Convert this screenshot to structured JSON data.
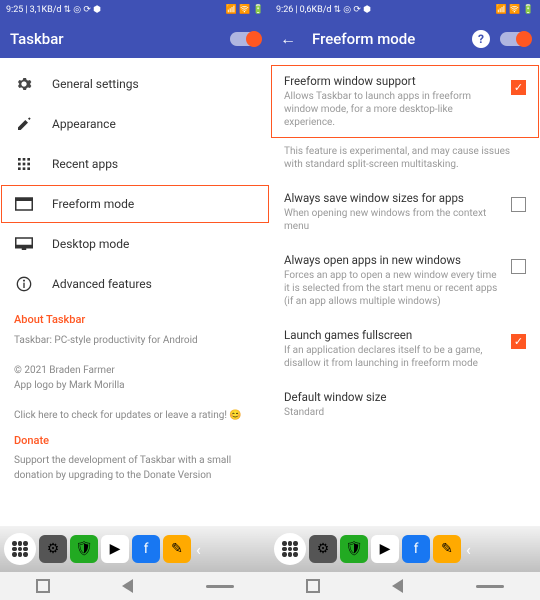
{
  "left": {
    "status": {
      "time": "9:25",
      "net": "3,1KB/d",
      "icons": "⇅ ◎ ⟳ ⬢"
    },
    "appTitle": "Taskbar",
    "menu": [
      {
        "label": "General settings",
        "icon": "gear"
      },
      {
        "label": "Appearance",
        "icon": "pencil"
      },
      {
        "label": "Recent apps",
        "icon": "grid"
      },
      {
        "label": "Freeform mode",
        "icon": "window"
      },
      {
        "label": "Desktop mode",
        "icon": "desktop"
      },
      {
        "label": "Advanced features",
        "icon": "info"
      }
    ],
    "about": {
      "heading": "About Taskbar",
      "tagline": "Taskbar: PC-style productivity for Android",
      "copyright": "© 2021 Braden Farmer",
      "logo": "App logo by Mark Morilla",
      "update": "Click here to check for updates or leave a rating! 😊",
      "donateHeading": "Donate",
      "donateText": "Support the development of Taskbar with a small donation by upgrading to the Donate Version"
    }
  },
  "right": {
    "status": {
      "time": "9:26",
      "net": "0,6KB/d",
      "icons": "⇅ ◎ ⟳ ⬢"
    },
    "appTitle": "Freeform mode",
    "settings": [
      {
        "title": "Freeform window support",
        "desc": "Allows Taskbar to launch apps in freeform window mode, for a more desktop-like experience.",
        "checked": true,
        "hl": true
      },
      {
        "title": "Always save window sizes for apps",
        "desc": "When opening new windows from the context menu",
        "checked": false
      },
      {
        "title": "Always open apps in new windows",
        "desc": "Forces an app to open a new window every time it is selected from the start menu or recent apps (if an app allows multiple windows)",
        "checked": false
      },
      {
        "title": "Launch games fullscreen",
        "desc": "If an application declares itself to be a game, disallow it from launching in freeform mode",
        "checked": true
      },
      {
        "title": "Default window size",
        "desc": "Standard",
        "nocb": true
      }
    ],
    "warning": "This feature is experimental, and may cause issues with standard split-screen multitasking."
  }
}
